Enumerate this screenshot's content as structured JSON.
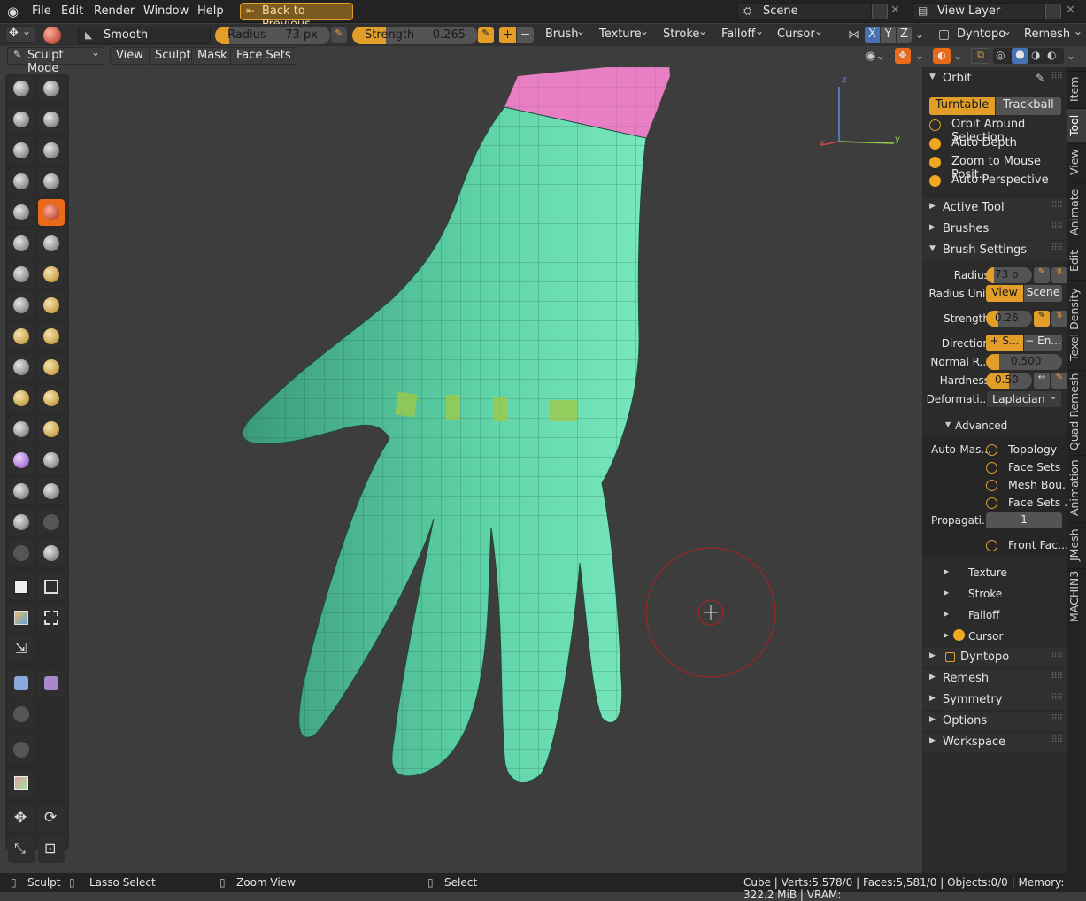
{
  "topbar": {
    "menus": [
      "File",
      "Edit",
      "Render",
      "Window",
      "Help"
    ],
    "back_label": "Back to Previous",
    "scene_label": "Scene",
    "view_layer_label": "View Layer"
  },
  "tool_header": {
    "brush_name": "Smooth",
    "radius_label": "Radius",
    "radius_value": "73 px",
    "radius_fraction": 0.07,
    "strength_label": "Strength",
    "strength_value": "0.265",
    "strength_fraction": 0.265,
    "plus_label": "+",
    "minus_label": "−",
    "menus": [
      "Brush",
      "Texture",
      "Stroke",
      "Falloff",
      "Cursor"
    ],
    "axes": [
      "X",
      "Y",
      "Z"
    ],
    "dyntopo_label": "Dyntopo",
    "remesh_label": "Remesh"
  },
  "mode_header": {
    "mode_label": "Sculpt Mode",
    "menus": [
      "View",
      "Sculpt",
      "Mask",
      "Face Sets"
    ]
  },
  "gizmo": {
    "z": "z",
    "y": "y",
    "x": "x"
  },
  "npanel": {
    "tabs": [
      "Item",
      "Tool",
      "View",
      "Animate",
      "Edit",
      "Texel Density",
      "Quad Remesh",
      "Animation",
      "JMesh",
      "MACHIN3"
    ],
    "active_tab": "Tool",
    "orbit": {
      "title": "Orbit",
      "turntable": "Turntable",
      "trackball": "Trackball",
      "options": [
        {
          "label": "Orbit Around Selection",
          "checked": false
        },
        {
          "label": "Auto Depth",
          "checked": true
        },
        {
          "label": "Zoom to Mouse Posit...",
          "checked": true
        },
        {
          "label": "Auto Perspective",
          "checked": true
        }
      ]
    },
    "active_tool": "Active Tool",
    "brushes": "Brushes",
    "brush_settings": {
      "title": "Brush Settings",
      "radius_label": "Radius",
      "radius_value": "73 p",
      "radius_unit_label": "Radius Unit",
      "unit_view": "View",
      "unit_scene": "Scene",
      "strength_label": "Strength",
      "strength_value": "0.26",
      "direction_label": "Direction",
      "dir_add": "+ S...",
      "dir_sub": "− En...",
      "normal_label": "Normal R...",
      "normal_value": "0.500",
      "hardness_label": "Hardness",
      "hardness_value": "0.50",
      "deform_label": "Deformati...",
      "deform_value": "Laplacian",
      "advanced": "Advanced",
      "automask_label": "Auto-Mas...",
      "automask": [
        "Topology",
        "Face Sets",
        "Mesh Bou...",
        "Face Sets ..."
      ],
      "propagation_label": "Propagati...",
      "propagation_value": "1",
      "front_faces": "Front Fac...",
      "sub": [
        "Texture",
        "Stroke",
        "Falloff",
        "Cursor"
      ]
    },
    "sections": [
      "Dyntopo",
      "Remesh",
      "Symmetry",
      "Options",
      "Workspace"
    ]
  },
  "statusbar": {
    "sculpt": "Sculpt",
    "lasso": "Lasso Select",
    "zoom": "Zoom View",
    "select": "Select",
    "stats": "Cube | Verts:5,578/0 | Faces:5,581/0 | Objects:0/0 | Memory: 322.2 MiB | VRAM:"
  },
  "colors": {
    "accent": "#e39e2a",
    "mesh": "#5fd4a8",
    "mask": "#e87ec4",
    "brush_circle": "#b02020"
  }
}
